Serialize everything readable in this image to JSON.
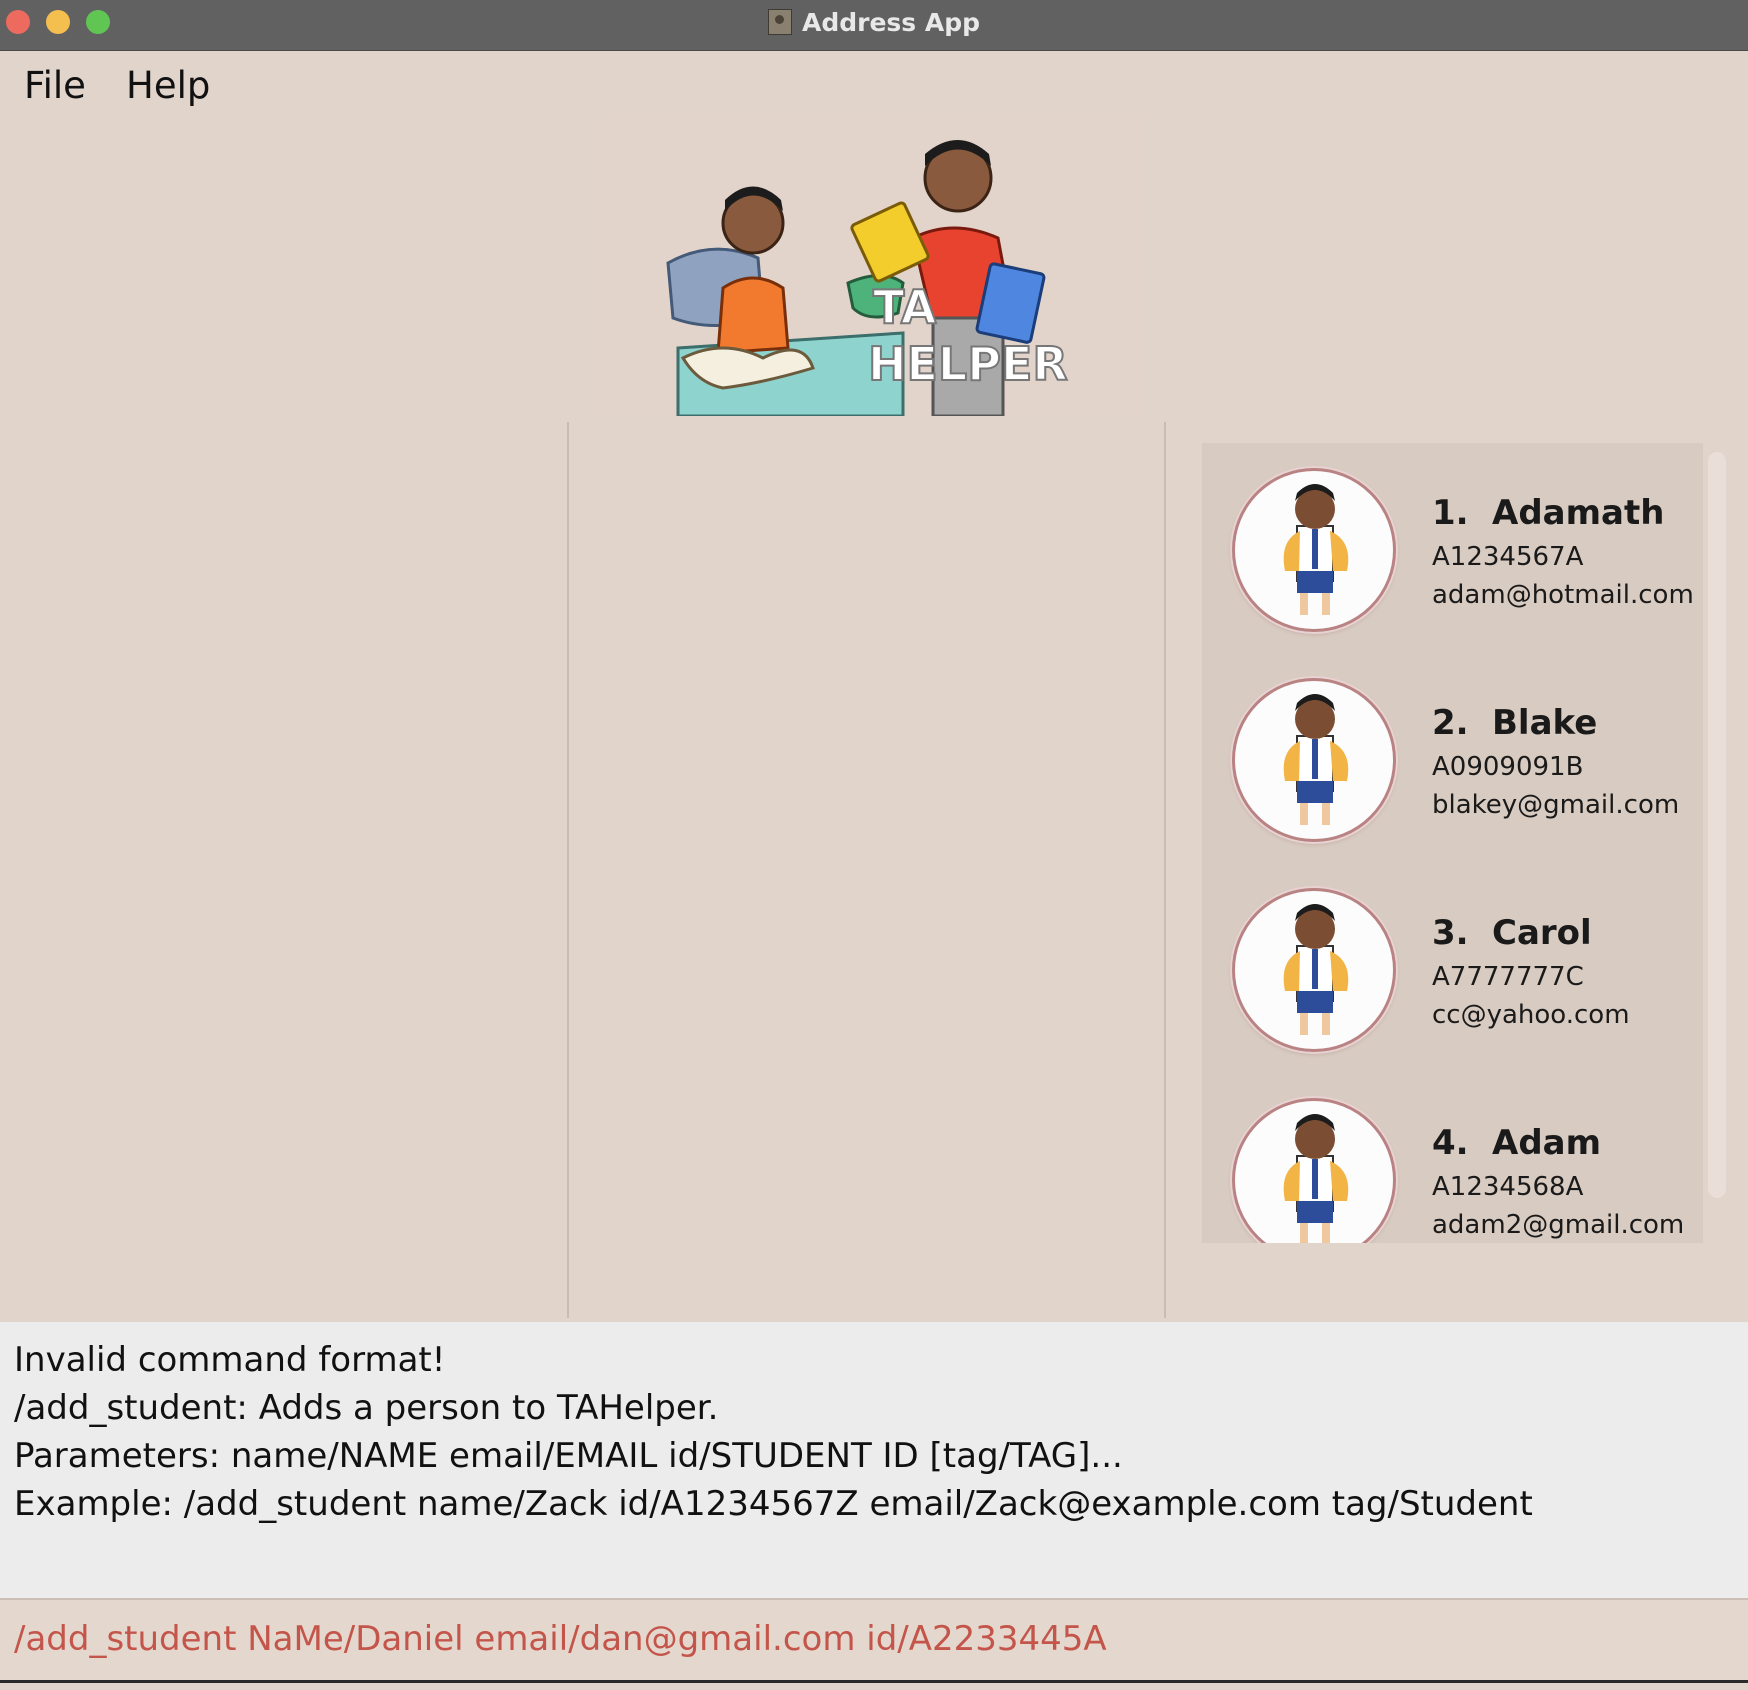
{
  "window": {
    "title": "Address App"
  },
  "menu": {
    "file": "File",
    "help": "Help"
  },
  "banner": {
    "line1": "TA",
    "line2": "HELPER"
  },
  "persons": [
    {
      "index": "1.",
      "name": "Adamath",
      "id": "A1234567A",
      "email": "adam@hotmail.com"
    },
    {
      "index": "2.",
      "name": "Blake",
      "id": "A0909091B",
      "email": "blakey@gmail.com"
    },
    {
      "index": "3.",
      "name": "Carol",
      "id": "A7777777C",
      "email": "cc@yahoo.com"
    },
    {
      "index": "4.",
      "name": "Adam",
      "id": "A1234568A",
      "email": "adam2@gmail.com"
    }
  ],
  "result": {
    "lines": [
      "Invalid command format!",
      "/add_student: Adds a person to TAHelper.",
      "Parameters: name/NAME email/EMAIL id/STUDENT ID [tag/TAG]...",
      "Example: /add_student name/Zack id/A1234567Z email/Zack@example.com tag/Student"
    ]
  },
  "command": {
    "value": "/add_student NaMe/Daniel email/dan@gmail.com id/A2233445A"
  },
  "colors": {
    "command_text": "#c4554a",
    "background": "#e0d4cb",
    "avatar_border": "#b98383"
  }
}
